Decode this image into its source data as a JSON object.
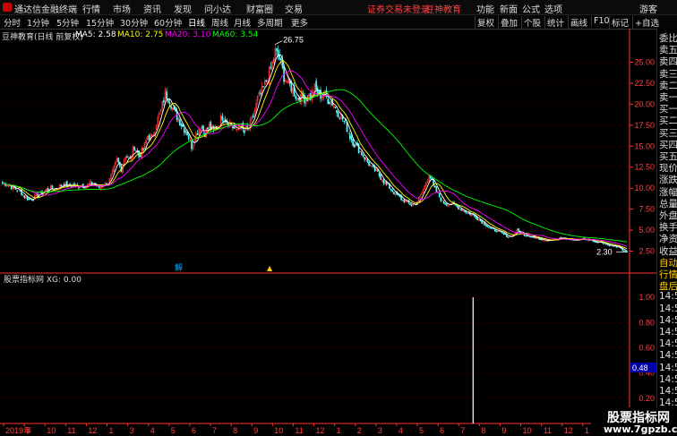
{
  "app": {
    "title": "通达信金融终端",
    "menu": [
      "行情",
      "市场",
      "资讯",
      "发现",
      "问小达",
      "财富圈",
      "交易"
    ],
    "login_status": "证券交易未登录",
    "brand": "豆神教育",
    "right_menu": [
      "功能",
      "新面",
      "公式",
      "选项"
    ],
    "guest": "游客"
  },
  "toolbar": {
    "periods": [
      "分时",
      "1分钟",
      "5分钟",
      "15分钟",
      "30分钟",
      "60分钟",
      "日线",
      "周线",
      "月线",
      "多周期",
      "更多"
    ],
    "active_period": "日线",
    "right_buttons": [
      "复权",
      "叠加",
      "个股",
      "统计",
      "画线",
      "F10",
      "标记",
      "+自选"
    ]
  },
  "main_info": {
    "title": "豆神教育(日线 前复权)",
    "ma5": "MA5: 2.58",
    "ma10": "MA10: 2.75",
    "ma20": "MA20: 3.10",
    "ma60": "MA60: 3.54"
  },
  "colors": {
    "ma5": "#ffffff",
    "ma10": "#ffff00",
    "ma20": "#ff00ff",
    "ma60": "#00ff00",
    "up": "#ff3232",
    "down": "#54ffff",
    "axis": "#ff3232"
  },
  "chart_data": {
    "type": "candlestick",
    "y_ticks": [
      "25.00",
      "22.50",
      "20.00",
      "17.50",
      "15.00",
      "12.50",
      "10.00",
      "7.50",
      "5.00",
      "2.50"
    ],
    "ylim": [
      0,
      27.5
    ],
    "annotations": {
      "high_label": "26.75",
      "low_label": "2.30"
    },
    "x_ticks": [
      "2019年",
      "9",
      "10",
      "11",
      "12",
      "1",
      "3",
      "4",
      "5",
      "6",
      "7",
      "8",
      "9",
      "10",
      "11",
      "12",
      "1",
      "2",
      "3",
      "4",
      "5",
      "6",
      "7",
      "8",
      "9",
      "10",
      "11",
      "12",
      "1",
      "2"
    ],
    "close_trend": [
      10.6,
      10.5,
      10.2,
      9.9,
      9.6,
      9.0,
      8.7,
      8.8,
      9.2,
      9.5,
      9.8,
      10.0,
      9.9,
      10.3,
      10.5,
      10.2,
      10.4,
      10.1,
      10.4,
      10.2,
      10.6,
      10.4,
      10.1,
      10.5,
      10.6,
      11.8,
      13.3,
      12.3,
      14.0,
      13.4,
      15.0,
      13.8,
      14.6,
      16.2,
      16.0,
      17.8,
      19.2,
      21.3,
      20.6,
      19.0,
      18.3,
      17.3,
      16.6,
      15.0,
      16.4,
      17.5,
      16.6,
      17.4,
      16.8,
      17.5,
      18.6,
      18.0,
      17.6,
      16.8,
      17.5,
      16.6,
      17.2,
      18.5,
      20.6,
      21.5,
      22.8,
      24.2,
      26.2,
      25.4,
      23.3,
      22.6,
      21.7,
      20.7,
      21.0,
      20.6,
      21.1,
      21.9,
      21.0,
      21.3,
      20.6,
      20.2,
      19.2,
      18.6,
      17.6,
      16.2,
      15.2,
      14.6,
      13.9,
      13.1,
      12.4,
      12.0,
      11.3,
      10.6,
      10.1,
      9.5,
      9.0,
      8.6,
      8.3,
      8.0,
      8.2,
      9.0,
      10.2,
      11.8,
      10.2,
      9.3,
      8.4,
      8.1,
      8.2,
      7.9,
      7.6,
      7.3,
      7.0,
      6.8,
      6.4,
      6.0,
      5.6,
      5.2,
      5.0,
      4.8,
      4.5,
      4.2,
      4.4,
      5.0,
      4.6,
      4.4,
      4.3,
      4.1,
      4.0,
      3.9,
      3.8,
      3.9,
      3.9,
      4.1,
      4.0,
      3.9,
      3.8,
      3.9,
      4.0,
      3.9,
      3.8,
      3.6,
      3.6,
      3.4,
      3.2,
      3.1,
      3.0,
      2.6,
      2.4
    ]
  },
  "sub_chart": {
    "title": "股票指标网 XG: 0.00",
    "y_ticks": [
      "1.00",
      "0.80",
      "0.60",
      "0.40",
      "0.20"
    ],
    "current_label": "0.48",
    "ylim": [
      0,
      1.1
    ],
    "signal": {
      "index": 107,
      "value": 1.0
    }
  },
  "right_panel": [
    "委比",
    "卖五",
    "卖四",
    "卖三",
    "卖二",
    "卖一",
    "买一",
    "买二",
    "买三",
    "买四",
    "买五",
    "现价",
    "涨跌",
    "涨幅",
    "总量",
    "外盘",
    "换手",
    "净资",
    "收益",
    "自动",
    "行情",
    "盘后",
    "14:5",
    "14:5",
    "14:5",
    "14:5",
    "14:5",
    "14:5",
    "14:5",
    "14:5",
    "14:5",
    "14:5",
    "14:5",
    "14:5"
  ],
  "markers": {
    "a": "解",
    "b": "▲"
  },
  "watermark": {
    "line1": "股票指标网",
    "line2": "www.7gpzb.com"
  }
}
